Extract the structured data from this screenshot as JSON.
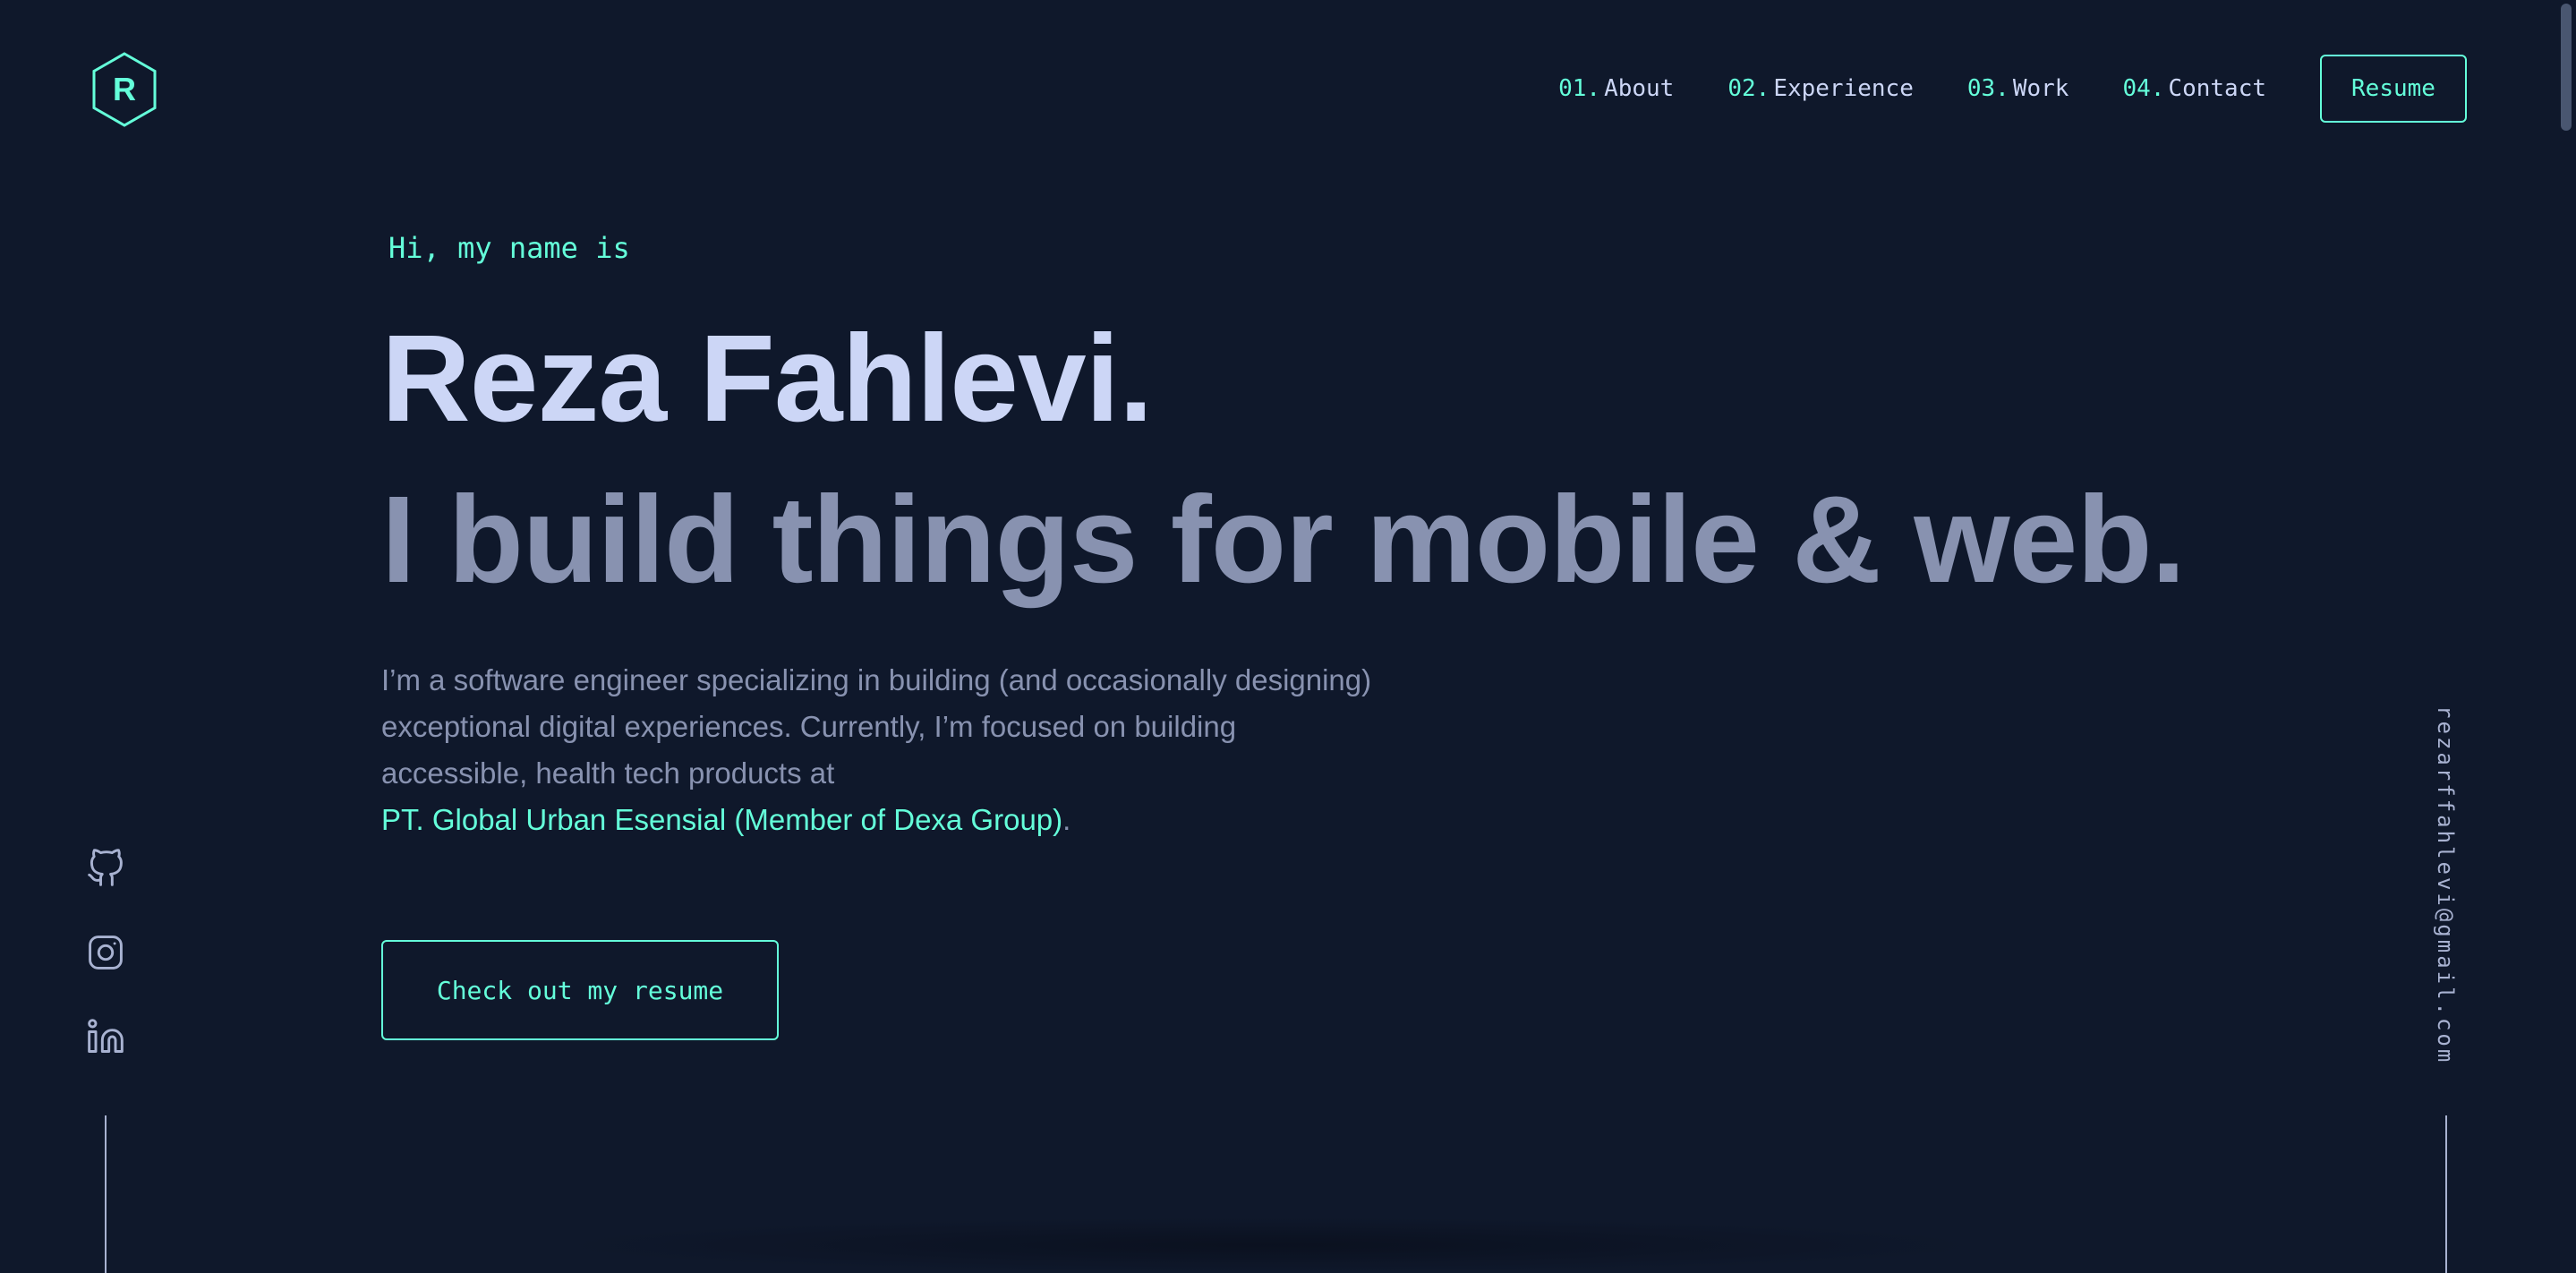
{
  "logo": {
    "letter": "R"
  },
  "nav": {
    "items": [
      {
        "num": "01.",
        "label": "About"
      },
      {
        "num": "02.",
        "label": "Experience"
      },
      {
        "num": "03.",
        "label": "Work"
      },
      {
        "num": "04.",
        "label": "Contact"
      }
    ],
    "resume_label": "Resume"
  },
  "hero": {
    "greeting": "Hi, my name is",
    "name": "Reza Fahlevi.",
    "tagline": "I build things for mobile & web.",
    "description": "I’m a software engineer specializing in building (and occasionally designing) exceptional digital experiences. Currently, I’m focused on building accessible, health tech products at",
    "company_link": "PT. Global Urban Esensial (Member of Dexa Group)",
    "description_end": ".",
    "cta_label": "Check out my resume"
  },
  "social": {
    "icons": [
      "github-icon",
      "instagram-icon",
      "linkedin-icon"
    ]
  },
  "email": "rezarffahlevi@gmail.com",
  "colors": {
    "background": "#0f182b",
    "accent": "#64ffda",
    "heading": "#ccd6f6",
    "muted": "#8892b0"
  }
}
